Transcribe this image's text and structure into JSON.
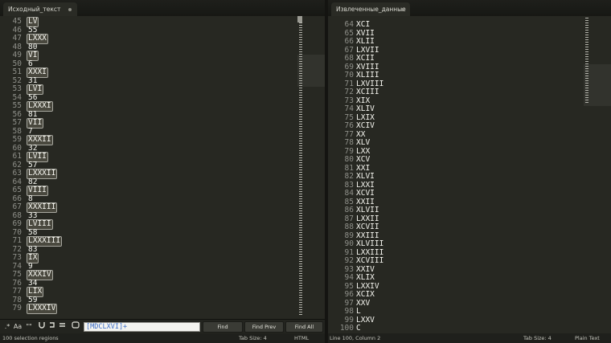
{
  "left_tab": {
    "title": "Исходный_текст"
  },
  "right_tab": {
    "title": "Извлеченные_данные"
  },
  "left_lines": [
    {
      "n": "45",
      "t": "LV",
      "sel": true
    },
    {
      "n": "46",
      "t": "55",
      "sel": false
    },
    {
      "n": "47",
      "t": "LXXX",
      "sel": true
    },
    {
      "n": "48",
      "t": "80",
      "sel": false
    },
    {
      "n": "49",
      "t": "VI",
      "sel": true
    },
    {
      "n": "50",
      "t": "6",
      "sel": false
    },
    {
      "n": "51",
      "t": "XXXI",
      "sel": true
    },
    {
      "n": "52",
      "t": "31",
      "sel": false
    },
    {
      "n": "53",
      "t": "LVI",
      "sel": true
    },
    {
      "n": "54",
      "t": "56",
      "sel": false
    },
    {
      "n": "55",
      "t": "LXXXI",
      "sel": true
    },
    {
      "n": "56",
      "t": "81",
      "sel": false
    },
    {
      "n": "57",
      "t": "VII",
      "sel": true
    },
    {
      "n": "58",
      "t": "7",
      "sel": false
    },
    {
      "n": "59",
      "t": "XXXII",
      "sel": true
    },
    {
      "n": "60",
      "t": "32",
      "sel": false
    },
    {
      "n": "61",
      "t": "LVII",
      "sel": true
    },
    {
      "n": "62",
      "t": "57",
      "sel": false
    },
    {
      "n": "63",
      "t": "LXXXII",
      "sel": true
    },
    {
      "n": "64",
      "t": "82",
      "sel": false
    },
    {
      "n": "65",
      "t": "VIII",
      "sel": true
    },
    {
      "n": "66",
      "t": "8",
      "sel": false
    },
    {
      "n": "67",
      "t": "XXXIII",
      "sel": true
    },
    {
      "n": "68",
      "t": "33",
      "sel": false
    },
    {
      "n": "69",
      "t": "LVIII",
      "sel": true
    },
    {
      "n": "70",
      "t": "58",
      "sel": false
    },
    {
      "n": "71",
      "t": "LXXXIII",
      "sel": true
    },
    {
      "n": "72",
      "t": "83",
      "sel": false
    },
    {
      "n": "73",
      "t": "IX",
      "sel": true
    },
    {
      "n": "74",
      "t": "9",
      "sel": false
    },
    {
      "n": "75",
      "t": "XXXIV",
      "sel": true
    },
    {
      "n": "76",
      "t": "34",
      "sel": false
    },
    {
      "n": "77",
      "t": "LIX",
      "sel": true
    },
    {
      "n": "78",
      "t": "59",
      "sel": false
    },
    {
      "n": "79",
      "t": "LXXXIV",
      "sel": true
    }
  ],
  "right_lines": [
    {
      "n": "64",
      "t": "XCI"
    },
    {
      "n": "65",
      "t": "XVII"
    },
    {
      "n": "66",
      "t": "XLII"
    },
    {
      "n": "67",
      "t": "LXVII"
    },
    {
      "n": "68",
      "t": "XCII"
    },
    {
      "n": "69",
      "t": "XVIII"
    },
    {
      "n": "70",
      "t": "XLIII"
    },
    {
      "n": "71",
      "t": "LXVIII"
    },
    {
      "n": "72",
      "t": "XCIII"
    },
    {
      "n": "73",
      "t": "XIX"
    },
    {
      "n": "74",
      "t": "XLIV"
    },
    {
      "n": "75",
      "t": "LXIX"
    },
    {
      "n": "76",
      "t": "XCIV"
    },
    {
      "n": "77",
      "t": "XX"
    },
    {
      "n": "78",
      "t": "XLV"
    },
    {
      "n": "79",
      "t": "LXX"
    },
    {
      "n": "80",
      "t": "XCV"
    },
    {
      "n": "81",
      "t": "XXI"
    },
    {
      "n": "82",
      "t": "XLVI"
    },
    {
      "n": "83",
      "t": "LXXI"
    },
    {
      "n": "84",
      "t": "XCVI"
    },
    {
      "n": "85",
      "t": "XXII"
    },
    {
      "n": "86",
      "t": "XLVII"
    },
    {
      "n": "87",
      "t": "LXXII"
    },
    {
      "n": "88",
      "t": "XCVII"
    },
    {
      "n": "89",
      "t": "XXIII"
    },
    {
      "n": "90",
      "t": "XLVIII"
    },
    {
      "n": "91",
      "t": "LXXIII"
    },
    {
      "n": "92",
      "t": "XCVIII"
    },
    {
      "n": "93",
      "t": "XXIV"
    },
    {
      "n": "94",
      "t": "XLIX"
    },
    {
      "n": "95",
      "t": "LXXIV"
    },
    {
      "n": "96",
      "t": "XCIX"
    },
    {
      "n": "97",
      "t": "XXV"
    },
    {
      "n": "98",
      "t": "L"
    },
    {
      "n": "99",
      "t": "LXXV"
    },
    {
      "n": "100",
      "t": "C"
    }
  ],
  "findbar": {
    "regex_label": ".*",
    "case_label": "Aa",
    "word_label": "\"\"",
    "query": "[MDCLXVI]+",
    "find_label": "Find",
    "find_prev_label": "Find Prev",
    "find_all_label": "Find All"
  },
  "status_left": {
    "selection": "100 selection regions",
    "tab_size": "Tab Size: 4",
    "syntax": "HTML"
  },
  "status_right": {
    "position": "Line 100, Column 2",
    "tab_size": "Tab Size: 4",
    "syntax": "Plain Text"
  }
}
